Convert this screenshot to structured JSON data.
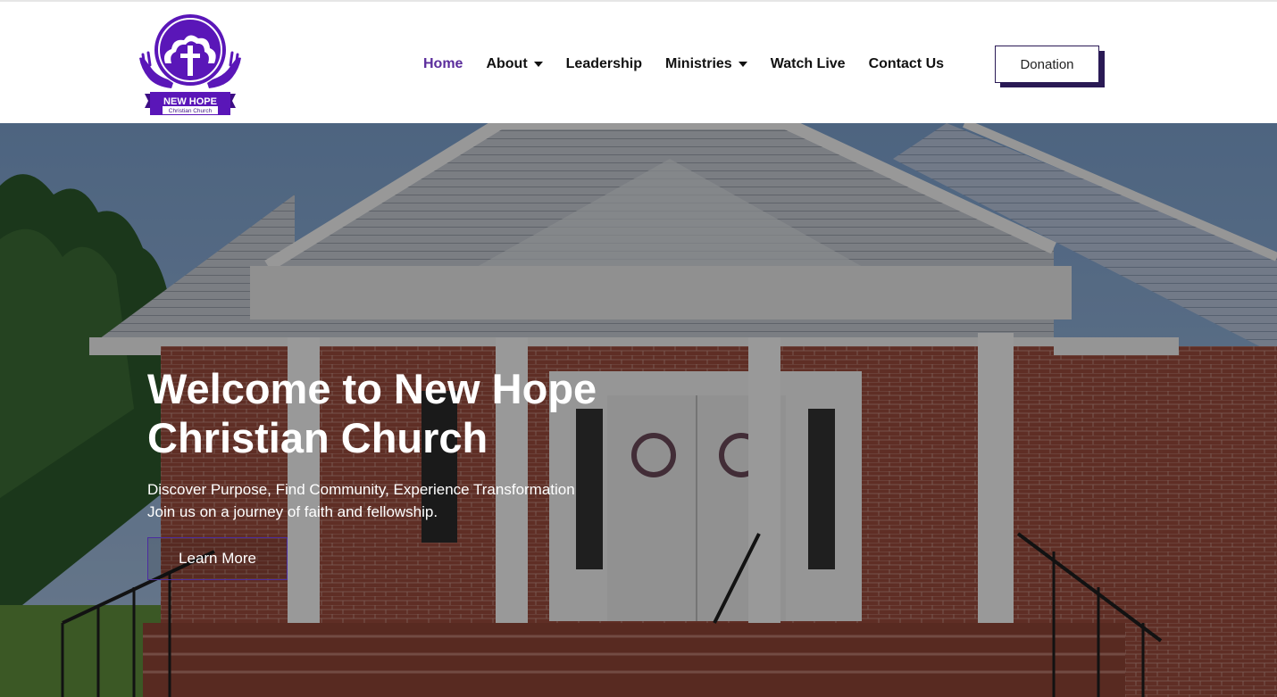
{
  "logo": {
    "name_line1": "NEW HOPE",
    "name_line2": "Christian Church",
    "icon": "cross-in-cloud-hands-logo",
    "color": "#5a16b8"
  },
  "nav": {
    "items": [
      {
        "label": "Home",
        "active": true,
        "has_dropdown": false
      },
      {
        "label": "About",
        "active": false,
        "has_dropdown": true
      },
      {
        "label": "Leadership",
        "active": false,
        "has_dropdown": false
      },
      {
        "label": "Ministries",
        "active": false,
        "has_dropdown": true
      },
      {
        "label": "Watch Live",
        "active": false,
        "has_dropdown": false
      },
      {
        "label": "Contact Us",
        "active": false,
        "has_dropdown": false
      }
    ],
    "active_color": "#5b2d9c",
    "dropdown_icon": "caret-down-icon"
  },
  "donation": {
    "label": "Donation",
    "shadow_color": "#2a1a55"
  },
  "hero": {
    "title_line1": "Welcome to New Hope",
    "title_line2": "Christian Church",
    "subtitle_line1": "Discover Purpose, Find Community, Experience Transformation",
    "subtitle_line2": "Join us on a journey of faith and fellowship.",
    "cta_label": "Learn More",
    "cta_border_color": "#4b2ca0",
    "background": "brick-church-photo"
  }
}
